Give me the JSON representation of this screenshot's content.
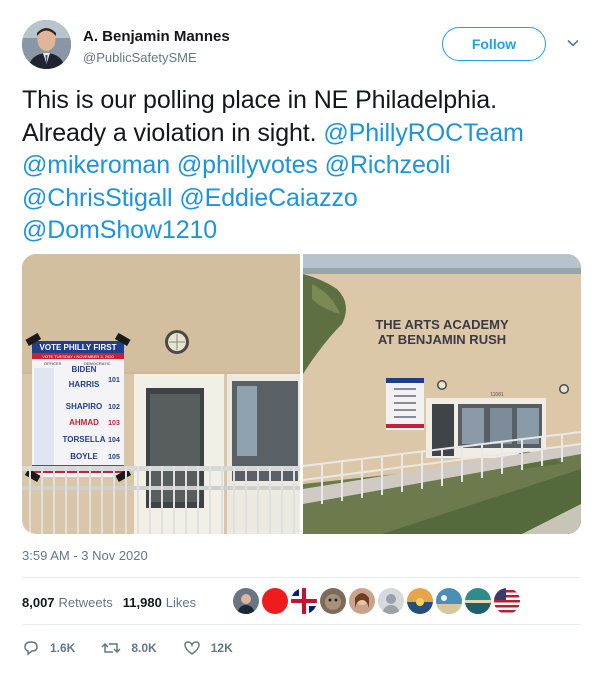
{
  "author": {
    "name": "A. Benjamin Mannes",
    "handle": "@PublicSafetySME",
    "follow_label": "Follow"
  },
  "tweet": {
    "text_line1": "This is our polling place in NE Philadelphia.",
    "text_line2_start": "Already a violation in sight. ",
    "mentions": [
      "@PhillyROCTeam",
      "@mikeroman",
      "@phillyvotes",
      "@Richzeoli",
      "@ChrisStigall",
      "@EddieCaiazzo",
      "@DomShow1210"
    ]
  },
  "photo_left": {
    "sign_title": "VOTE PHILLY FIRST",
    "sign_date": "VOTE TUESDAY • NOVEMBER 3, 2020",
    "sign_col_offices": "OFFICES",
    "sign_col_party": "DEMOCRATIC",
    "sign_candidates": [
      {
        "name": "BIDEN",
        "number": ""
      },
      {
        "name": "HARRIS",
        "number": "101"
      },
      {
        "name": "SHAPIRO",
        "number": "102"
      },
      {
        "name": "AHMAD",
        "number": "103"
      },
      {
        "name": "TORSELLA",
        "number": "104"
      },
      {
        "name": "BOYLE",
        "number": "105"
      }
    ],
    "sign_footer": "• POLLS OPEN 7:00 A.M. TO 8:00 P.M. •"
  },
  "photo_right": {
    "building_sign_line1": "THE ARTS ACADEMY",
    "building_sign_line2": "AT BENJAMIN RUSH",
    "address_number": "11081"
  },
  "meta": {
    "timestamp": "3:59 AM - 3 Nov 2020"
  },
  "stats": {
    "retweets_count": "8,007",
    "retweets_label": "Retweets",
    "likes_count": "11,980",
    "likes_label": "Likes"
  },
  "actions": {
    "reply_count": "1.6K",
    "retweet_count": "8.0K",
    "like_count": "12K"
  },
  "colors": {
    "link": "#1b95e0",
    "follow_border": "#1da1f2",
    "muted": "#657786",
    "divider": "#e6ecf0"
  },
  "icons": [
    "chevron-down-icon",
    "reply-icon",
    "retweet-icon",
    "heart-icon"
  ]
}
